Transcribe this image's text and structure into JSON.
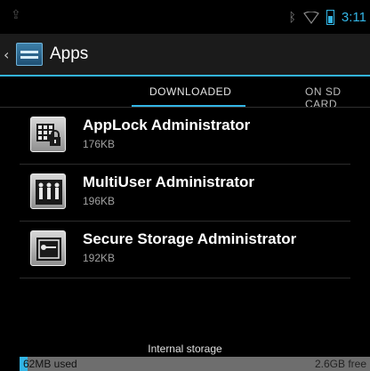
{
  "status_bar": {
    "time": "3:11",
    "icons": [
      "usb-icon",
      "bluetooth-icon",
      "wifi-icon",
      "battery-icon"
    ],
    "accent_color": "#33b5e5"
  },
  "action_bar": {
    "title": "Apps",
    "icons": [
      "back-arrow-icon",
      "settings-app-icon"
    ]
  },
  "tabs": [
    {
      "label": "DOWNLOADED",
      "selected": true
    },
    {
      "label": "ON SD CARD",
      "selected": false
    }
  ],
  "apps": [
    {
      "name": "AppLock Administrator",
      "size": "176KB",
      "icon": "applock-icon"
    },
    {
      "name": "MultiUser Administrator",
      "size": "196KB",
      "icon": "multiuser-icon"
    },
    {
      "name": "Secure Storage Administrator",
      "size": "192KB",
      "icon": "secure-storage-icon"
    }
  ],
  "storage": {
    "label": "Internal storage",
    "used": "62MB used",
    "free": "2.6GB free",
    "used_fraction": 0.023
  }
}
